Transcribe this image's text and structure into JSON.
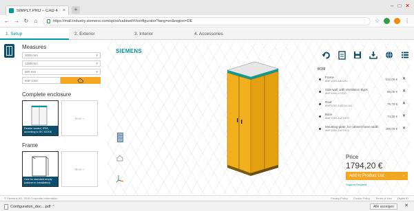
{
  "browser": {
    "tab_title": "SIMPLY.PRO – CAD 4",
    "url": "https://mall.industry.siemens.com/spice/cabinet/#/configurator?lang=en&region=DE",
    "window_controls": [
      "–",
      "□",
      "✕"
    ]
  },
  "steps": [
    {
      "label": "1. Setup"
    },
    {
      "label": "2. Exterior"
    },
    {
      "label": "3. Interior"
    },
    {
      "label": "4. Accessories"
    }
  ],
  "measures": {
    "title": "Measures",
    "selects": [
      {
        "value": "2000 mm"
      },
      {
        "value": "1200 mm"
      },
      {
        "value": "600 mm"
      }
    ],
    "sku_input": "8MF1050"
  },
  "complete_enclosure": {
    "title": "Complete enclosure",
    "cards": [
      {
        "caption": "Reader sealed, IP55, according to IEC 62208",
        "selected": true
      },
      {
        "caption": "More »",
        "selected": false
      }
    ]
  },
  "frame": {
    "title": "Frame",
    "cards": [
      {
        "caption": "Hole for standard empty (cabinet in Installation)",
        "selected": true
      },
      {
        "caption": "More »",
        "selected": false
      }
    ]
  },
  "brand": "SIEMENS",
  "bom": {
    "title": "BOM",
    "items": [
      {
        "name": "Frame",
        "sub": "8MF1050-2BA200",
        "price": "512,00 €"
      },
      {
        "name": "Side wall, with Ventilation Byps",
        "sub": "8MF1050-2GS10",
        "price": "86,00 €"
      },
      {
        "name": "Roof",
        "sub": "8MF1050-2UD114-0A",
        "price": "78,79 €"
      },
      {
        "name": "Base",
        "sub": "8MF1050-2UF1000",
        "price": "74,35 €"
      },
      {
        "name": "Mounting plate, for cabinet frame width",
        "sub": "8MF1050-2UF1013",
        "price": "298,00 €"
      }
    ]
  },
  "price": {
    "label": "Price",
    "value": "1794,20 €",
    "add_button": "Add to Product List",
    "add_arrow": "›",
    "support_link": "Support Request"
  },
  "footer": {
    "copyright": "© Siemens AG, 2018 Corporate Information",
    "links": [
      "Privacy Policy",
      "Cookie Policy",
      "Terms of Use",
      "Digital ID"
    ]
  },
  "download": {
    "filename": "Configuration_doc....pdf",
    "caret": "^",
    "show_all": "Alle anzeigen",
    "close": "✕"
  },
  "colors": {
    "accent": "#009999",
    "cta": "#f5a623",
    "cabinet": "#f2b01e",
    "navy": "#0b4f6c"
  }
}
